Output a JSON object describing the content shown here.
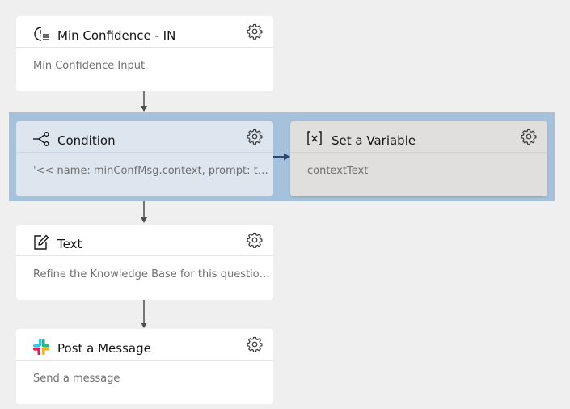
{
  "flow": {
    "nodes": [
      {
        "title": "Min Confidence - IN",
        "subtitle": "Min Confidence Input",
        "icon": "confidence-icon"
      },
      {
        "title": "Condition",
        "subtitle": "'<< name: minConfMsg.context, prompt: true >>",
        "icon": "branch-icon"
      },
      {
        "title": "Set a Variable",
        "subtitle": "contextText",
        "icon": "variable-icon"
      },
      {
        "title": "Text",
        "subtitle": "Refine the Knowledge Base for this question...",
        "icon": "edit-icon"
      },
      {
        "title": "Post a Message",
        "subtitle": "Send a message",
        "icon": "slack-icon"
      }
    ]
  },
  "colors": {
    "canvas": "#efefef",
    "card": "#ffffff",
    "group_highlight": "#a6c1dc",
    "connector": "#4d4d4d",
    "slack": [
      "#36c5f0",
      "#2eb67d",
      "#ecb22e",
      "#e01e5a"
    ]
  }
}
